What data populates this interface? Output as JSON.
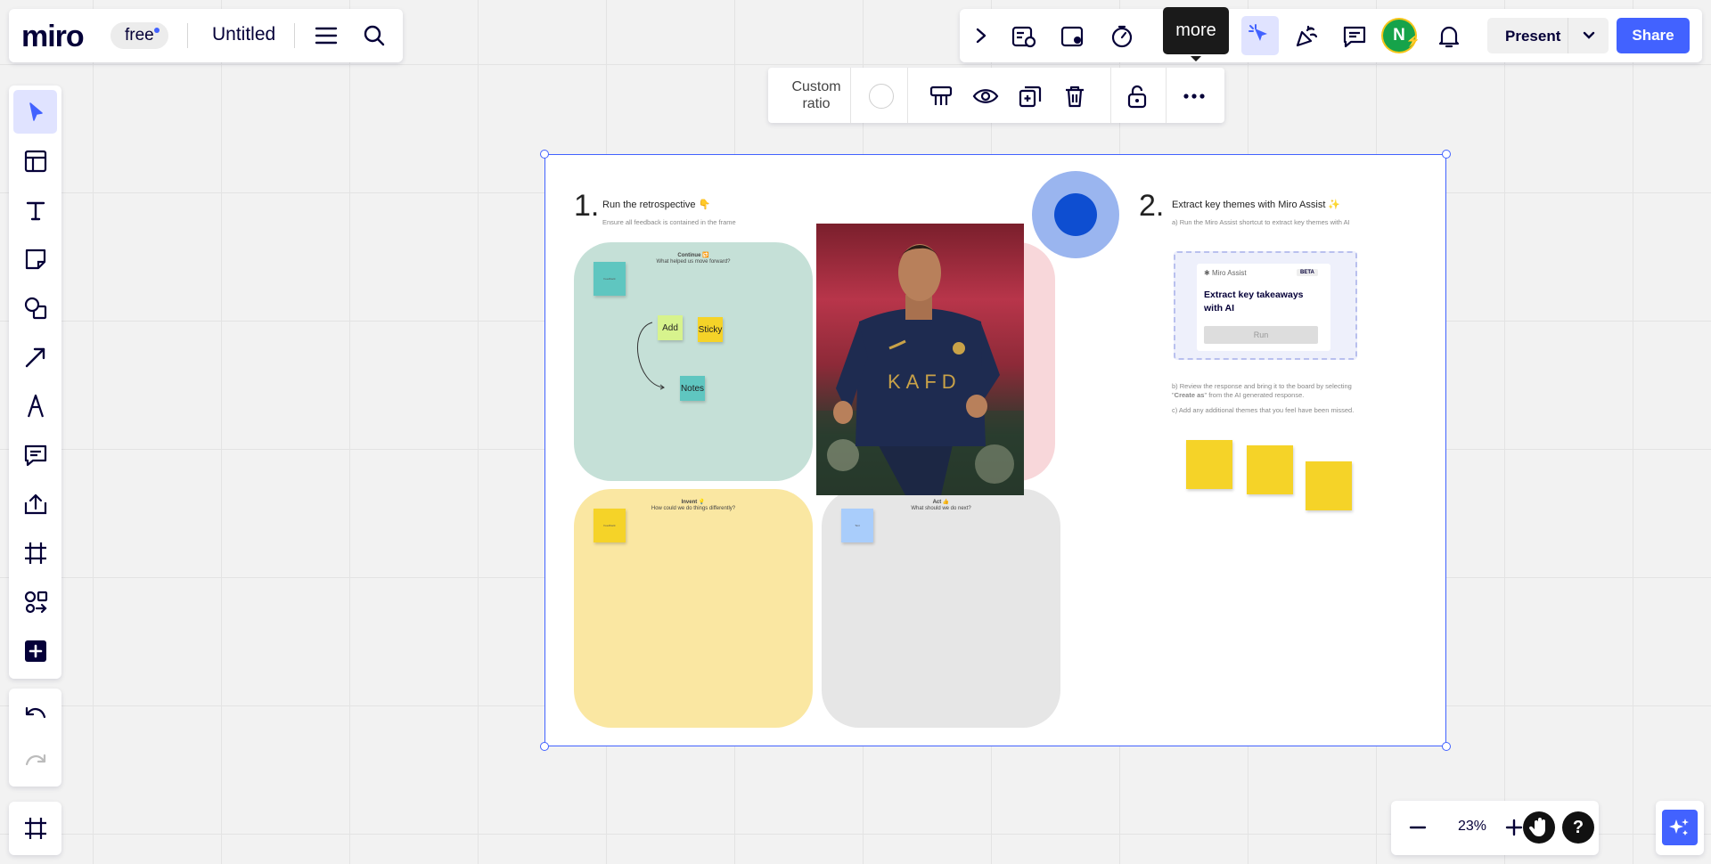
{
  "header": {
    "logo": "miro",
    "plan": "free",
    "board_title": "Untitled"
  },
  "top_right": {
    "tooltip": "more",
    "avatar_initial": "N",
    "present_label": "Present",
    "share_label": "Share"
  },
  "context_toolbar": {
    "ratio_label": "Custom ratio"
  },
  "zoom": {
    "value": "23%"
  },
  "help": {
    "label": "?"
  },
  "board": {
    "step1": {
      "number": "1.",
      "title": "Run the retrospective 👇",
      "subtitle": "Ensure all feedback is contained in the frame"
    },
    "quadrants": {
      "continue": {
        "title": "Continue 🔁",
        "question": "What helped us move forward?",
        "sticky": "Feedback"
      },
      "invent": {
        "title": "Invent 💡",
        "question": "How could we do things differently?",
        "sticky": "Feedback"
      },
      "act": {
        "title": "Act 👍",
        "question": "What should we do next?",
        "sticky": "Text"
      }
    },
    "flow_stickies": {
      "add": "Add",
      "sticky": "Sticky",
      "notes": "Notes"
    },
    "step2": {
      "number": "2.",
      "title": "Extract key themes with Miro Assist ✨",
      "subtitle": "a) Run the Miro Assist shortcut to extract key themes with AI",
      "b_prefix": "b) Review the response and bring it to the board by selecting \"",
      "b_bold": "Create as",
      "b_suffix": "\" from the AI generated response.",
      "c_text": "c) Add any additional themes that you feel have been missed."
    },
    "assist_card": {
      "brand": "Miro Assist",
      "badge": "BETA",
      "heading": "Extract key takeaways with AI",
      "run_label": "Run"
    }
  },
  "colors": {
    "accent": "#4262ff",
    "continue_bg": "#c5e0d7",
    "invent_bg": "#fae7a2",
    "act_bg": "#e6e6e6",
    "pink_bg": "#f8d7da",
    "yellow_sticky": "#f5d328"
  }
}
